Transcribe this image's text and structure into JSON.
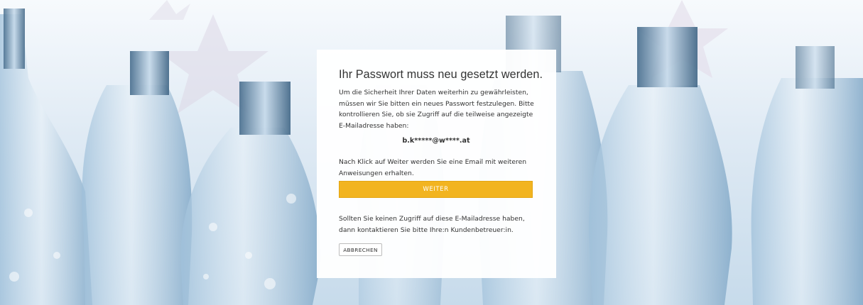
{
  "background": {
    "description_icon": "plastic-bottles-image"
  },
  "card": {
    "title": "Ihr Passwort muss neu gesetzt werden.",
    "intro": "Um die Sicherheit Ihrer Daten weiterhin zu gewährleisten, müssen wir Sie bitten ein neues Passwort festzulegen. Bitte kontrollieren Sie, ob sie Zugriff auf die teilweise angezeigte E-Mailadresse haben:",
    "masked_email": "b.k*****@w****.at",
    "next_info": "Nach Klick auf Weiter werden Sie eine Email mit weiteren Anweisungen erhalten.",
    "next_button": "WEITER",
    "no_access_info": "Sollten Sie keinen Zugriff auf diese E-Mailadresse haben, dann kontaktieren Sie bitte Ihre:n Kundenbetreuer:in.",
    "cancel_button": "ABBRECHEN"
  },
  "colors": {
    "accent": "#f2b420",
    "text": "#333333",
    "card_bg": "#ffffff"
  }
}
